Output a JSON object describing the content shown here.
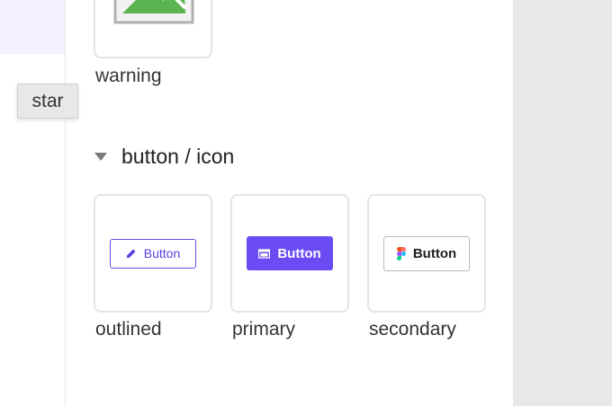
{
  "tooltip": {
    "text": "star"
  },
  "top_card": {
    "label": "warning",
    "icon": "broken-image-icon"
  },
  "section": {
    "title": "button / icon",
    "caret_icon": "caret-down-icon"
  },
  "cards": [
    {
      "label": "outlined",
      "button_label": "Button",
      "icon": "pencil-icon"
    },
    {
      "label": "primary",
      "button_label": "Button",
      "icon": "window-icon"
    },
    {
      "label": "secondary",
      "button_label": "Button",
      "icon": "figma-logo-icon"
    }
  ],
  "colors": {
    "accent": "#6b4cf2",
    "highlight": "#f3f0ff",
    "card_border": "#e4e4e4",
    "gray_panel": "#e8e8e8"
  }
}
